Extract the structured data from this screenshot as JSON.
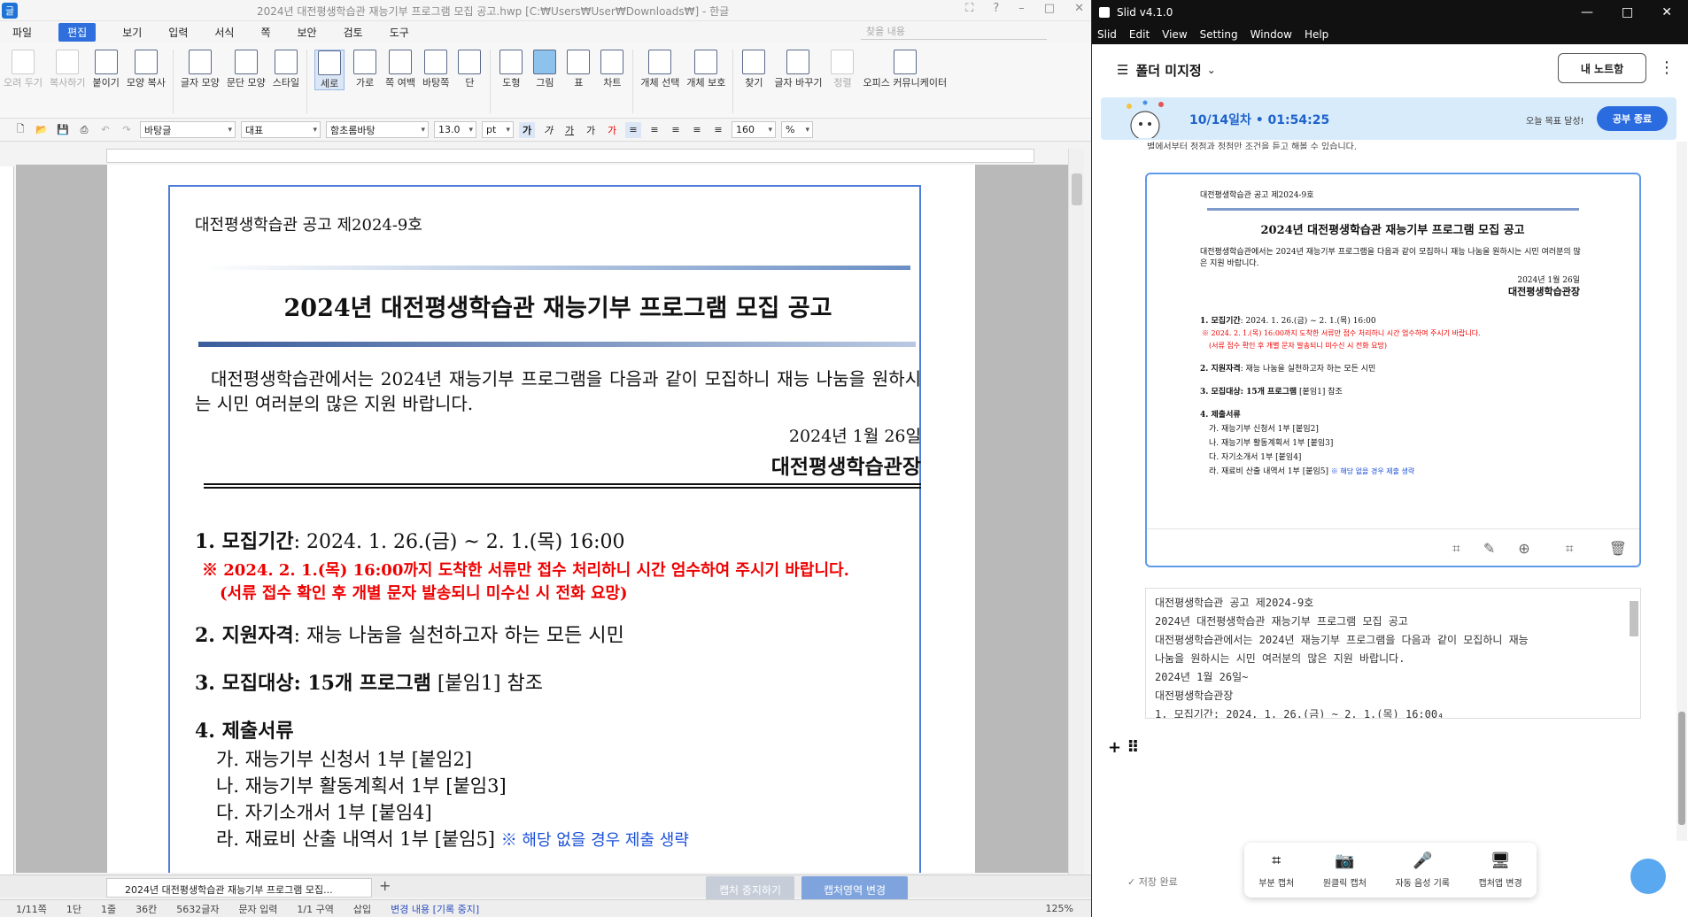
{
  "hwp": {
    "window_title": "2024년 대전평생학습관 재능기부 프로그램 모집 공고.hwp [C:₩Users₩User₩Downloads₩] - 한글",
    "menu": [
      "파일",
      "편집",
      "보기",
      "입력",
      "서식",
      "쪽",
      "보안",
      "검토",
      "도구"
    ],
    "menu_active": "편집",
    "search_placeholder": "찾을 내용",
    "ribbon": [
      "오려 두기",
      "복사하기",
      "붙이기",
      "모양 복사",
      "글자 모양",
      "문단 모양",
      "스타일",
      "세로",
      "가로",
      "쪽 여백",
      "바탕쪽",
      "단",
      "도형",
      "그림",
      "표",
      "차트",
      "개체 선택",
      "개체 보호",
      "찾기",
      "글자 바꾸기",
      "정렬",
      "오피스 커뮤니케이터"
    ],
    "fmt": {
      "style": "바탕글",
      "font_lang": "대표",
      "font": "함초롬바탕",
      "size": "13.0",
      "unit": "pt",
      "zoom": "160",
      "zoom_unit": "%"
    },
    "doc": {
      "number": "대전평생학습관 공고 제2024-9호",
      "title": "2024년 대전평생학습관 재능기부 프로그램 모집 공고",
      "intro": "대전평생학습관에서는 2024년 재능기부 프로그램을 다음과 같이 모집하니 재능 나눔을 원하시는 시민 여러분의 많은 지원 바랍니다.",
      "date": "2024년 1월 26일",
      "org": "대전평생학습관장",
      "i1_label": "1. 모집기간",
      "i1_value": ": 2024. 1. 26.(금) ~ 2. 1.(목) 16:00",
      "note1": "※ 2024. 2. 1.(목) 16:00까지 도착한 서류만 접수 처리하니 시간 엄수하여 주시기 바랍니다.",
      "note2": "(서류 접수 확인 후 개별 문자 발송되니 미수신 시 전화 요망)",
      "i2_label": "2. 지원자격",
      "i2_value": ": 재능 나눔을 실천하고자 하는 모든 시민",
      "i3_label": "3. 모집대상: 15개 프로그램",
      "i3_value": "[붙임1] 참조",
      "i4_label": "4. 제출서류",
      "s1": "가. 재능기부 신청서 1부 [붙임2]",
      "s2": "나. 재능기부 활동계획서 1부 [붙임3]",
      "s3": "다. 자기소개서 1부 [붙임4]",
      "s4": "라. 재료비 산출 내역서 1부 [붙임5]",
      "s4_note": "※ 해당 없을 경우 제출 생략"
    },
    "tab": "2024년 대전평생학습관 재능기부 프로그램 모집...",
    "capture_stop": "캡처 중지하기",
    "capture_change": "캡처영역 변경",
    "status": [
      "1/11쪽",
      "1단",
      "1줄",
      "36칸",
      "5632글자",
      "문자 입력",
      "1/1 구역",
      "삽입",
      "변경 내용 [기록 중지]"
    ],
    "zoom_status": "125%"
  },
  "slid": {
    "title": "Slid v4.1.0",
    "menu": [
      "Slid",
      "Edit",
      "View",
      "Setting",
      "Window",
      "Help"
    ],
    "folder": "폴더 미지정",
    "notebook_button": "내 노트함",
    "timer": "10/14일차 • 01:54:25",
    "goal": "오늘 목표 달성!",
    "end_button": "공부 종료",
    "prev_text": "별에서부터 정점과 정점만 조건을 듣고 해볼 수 있습니다.",
    "ocr_lines": [
      "대전평생학습관 공고 제2024-9호",
      "2024년 대전평생학습관 재능기부 프로그램 모집 공고",
      "대전평생학습관에서는 2024년 재능기부 프로그램을 다음과 같이 모집하니 재능",
      "나눔을 원하시는 시민 여러분의 많은 지원 바랍니다.",
      "2024년 1월 26일~",
      "대전평생학습관장",
      "1. 모집기간: 2024. 1. 26.(금) ~ 2. 1.(목) 16:00₄"
    ],
    "save_status": "저장 완료",
    "bottom": [
      "부분 캡처",
      "원클릭 캡처",
      "자동 음성 기록",
      "캡처앱 변경"
    ],
    "colors": {
      "accent": "#2b6be0",
      "card_border": "#5e9ae8",
      "timer_bg": "#d8ebfb"
    }
  }
}
